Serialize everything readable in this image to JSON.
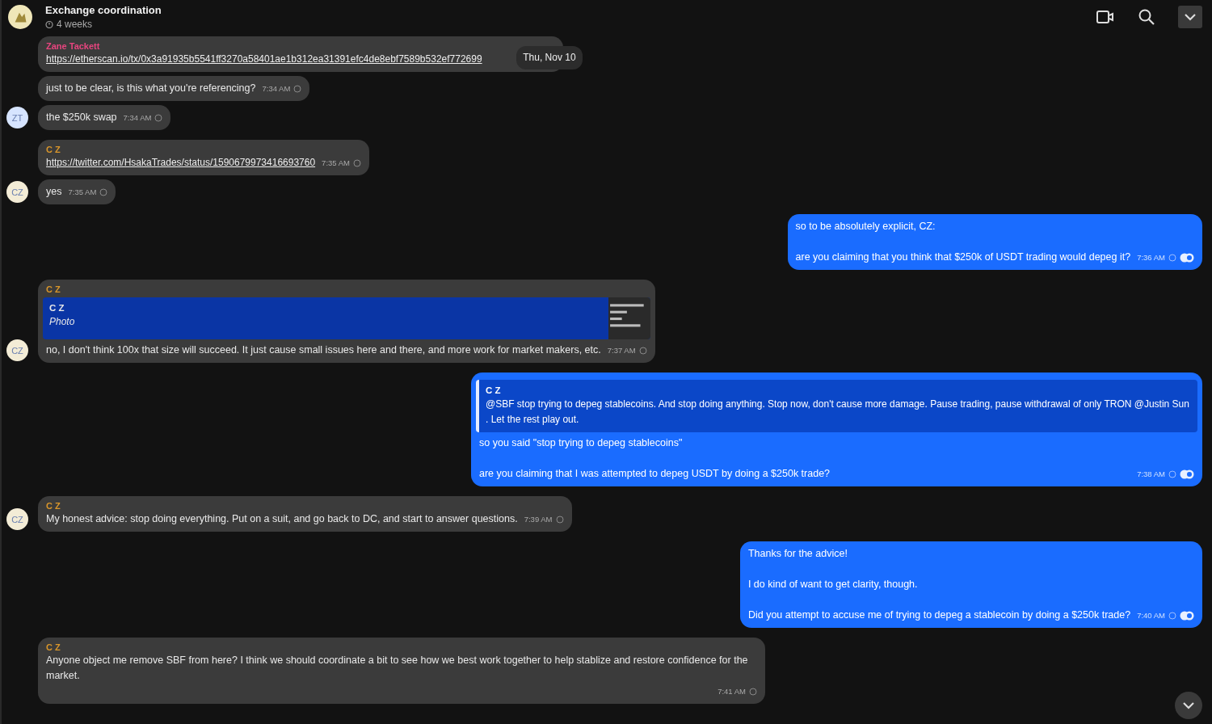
{
  "header": {
    "title": "Exchange coordination",
    "timer": "4 weeks"
  },
  "messages": [
    {
      "outgoing": false,
      "sender": {
        "name": "Zane Tackett",
        "color": "#e8457f"
      },
      "body": [
        {
          "kind": "link",
          "text": "https://etherscan.io/tx/0x3a91935b5541ff3270a58401ae1b312ea31391efc4de8ebf7589b532ef772699"
        }
      ],
      "tooltip": "Thu, Nov 10"
    },
    {
      "outgoing": false,
      "body": [
        {
          "kind": "text",
          "text": "just to be clear, is this what you're referencing?"
        }
      ],
      "time": "7:34 AM"
    },
    {
      "outgoing": false,
      "avatar": {
        "initials": "ZT",
        "color": "#d6e4ff"
      },
      "body": [
        {
          "kind": "text",
          "text": "the $250k swap"
        }
      ],
      "time": "7:34 AM"
    },
    {
      "outgoing": false,
      "sender": {
        "name": "C Z",
        "color": "#d9962b"
      },
      "body": [
        {
          "kind": "link",
          "text": "https://twitter.com/HsakaTrades/status/1590679973416693760"
        }
      ],
      "time": "7:35 AM"
    },
    {
      "outgoing": false,
      "avatar": {
        "initials": "CZ",
        "color": "#f3ecd6"
      },
      "body": [
        {
          "kind": "text",
          "text": "yes"
        }
      ],
      "time": "7:35 AM"
    },
    {
      "outgoing": true,
      "body": [
        {
          "kind": "text",
          "text": "so to be absolutely explicit, CZ:"
        },
        {
          "kind": "text",
          "text": "are you claiming that you think that $250k of USDT trading would depeg it?"
        }
      ],
      "time": "7:36 AM"
    },
    {
      "outgoing": false,
      "sender": {
        "name": "C Z",
        "color": "#d9962b"
      },
      "avatar": {
        "initials": "CZ",
        "color": "#f3ecd6"
      },
      "quote": {
        "author": "C Z",
        "text": "Photo"
      },
      "body": [
        {
          "kind": "text",
          "text": "no, I don't think 100x that size will succeed. It just cause small issues here and there, and more work for market makers, etc."
        }
      ],
      "time": "7:37 AM"
    },
    {
      "outgoing": true,
      "quote": {
        "author": "C Z",
        "text": "@SBF  stop trying to depeg stablecoins. And stop doing anything. Stop now, don't cause more damage. Pause trading, pause withdrawal of only TRON @Justin Sun . Let the rest play out.",
        "kind": "text"
      },
      "body": [
        {
          "kind": "text",
          "text": "so you said \"stop trying to depeg stablecoins\""
        },
        {
          "kind": "text",
          "text": "are you claiming that I was attempted to depeg USDT by doing a $250k trade?"
        }
      ],
      "time": "7:38 AM"
    },
    {
      "outgoing": false,
      "sender": {
        "name": "C Z",
        "color": "#d9962b"
      },
      "avatar": {
        "initials": "CZ",
        "color": "#f3ecd6"
      },
      "body": [
        {
          "kind": "text",
          "text": "My honest advice: stop doing everything. Put on a suit, and go back to DC, and start to answer questions."
        }
      ],
      "time": "7:39 AM"
    },
    {
      "outgoing": true,
      "body": [
        {
          "kind": "text",
          "text": "Thanks for the advice!"
        },
        {
          "kind": "text",
          "text": "I do kind of want to get clarity, though."
        },
        {
          "kind": "text",
          "text": "Did you attempt to accuse me of trying to depeg a stablecoin by doing a $250k trade?"
        }
      ],
      "time": "7:40 AM"
    },
    {
      "outgoing": false,
      "sender": {
        "name": "C Z",
        "color": "#d9962b"
      },
      "body": [
        {
          "kind": "text",
          "text": "Anyone object me remove SBF from here? I think we should coordinate a bit to see how we best work together to help stablize and restore confidence for the market."
        }
      ],
      "time": "7:41 AM"
    }
  ]
}
